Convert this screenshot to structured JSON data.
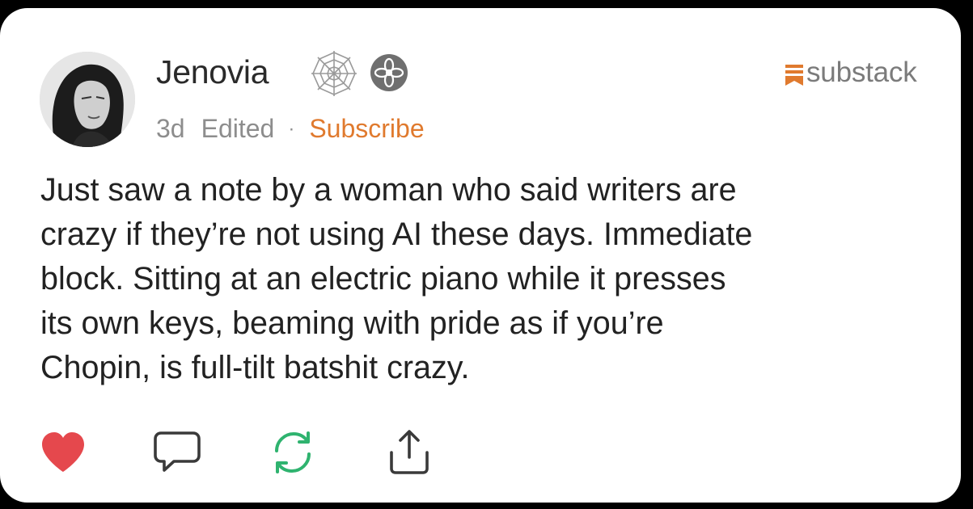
{
  "post": {
    "author": "Jenovia",
    "age": "3d",
    "edited": "Edited",
    "separator": "·",
    "subscribe_label": "Subscribe",
    "brand": "substack",
    "body": "Just saw a note by a woman who said writers are\ncrazy if they’re not using AI these days. Immediate\nblock. Sitting at an electric piano while it presses\nits own keys, beaming with pride as if you’re\nChopin, is full-tilt batshit crazy."
  },
  "icons": {
    "badges": [
      "spiderweb-icon",
      "flower-badge-icon"
    ],
    "brand_mark": "substack-logo-icon",
    "actions": [
      "heart-icon",
      "comment-icon",
      "restack-icon",
      "share-icon"
    ]
  },
  "colors": {
    "accent": "#e07a2e",
    "like": "#e5484d",
    "restack": "#2fb36f",
    "text": "#222222",
    "muted": "#8d8d8d"
  }
}
